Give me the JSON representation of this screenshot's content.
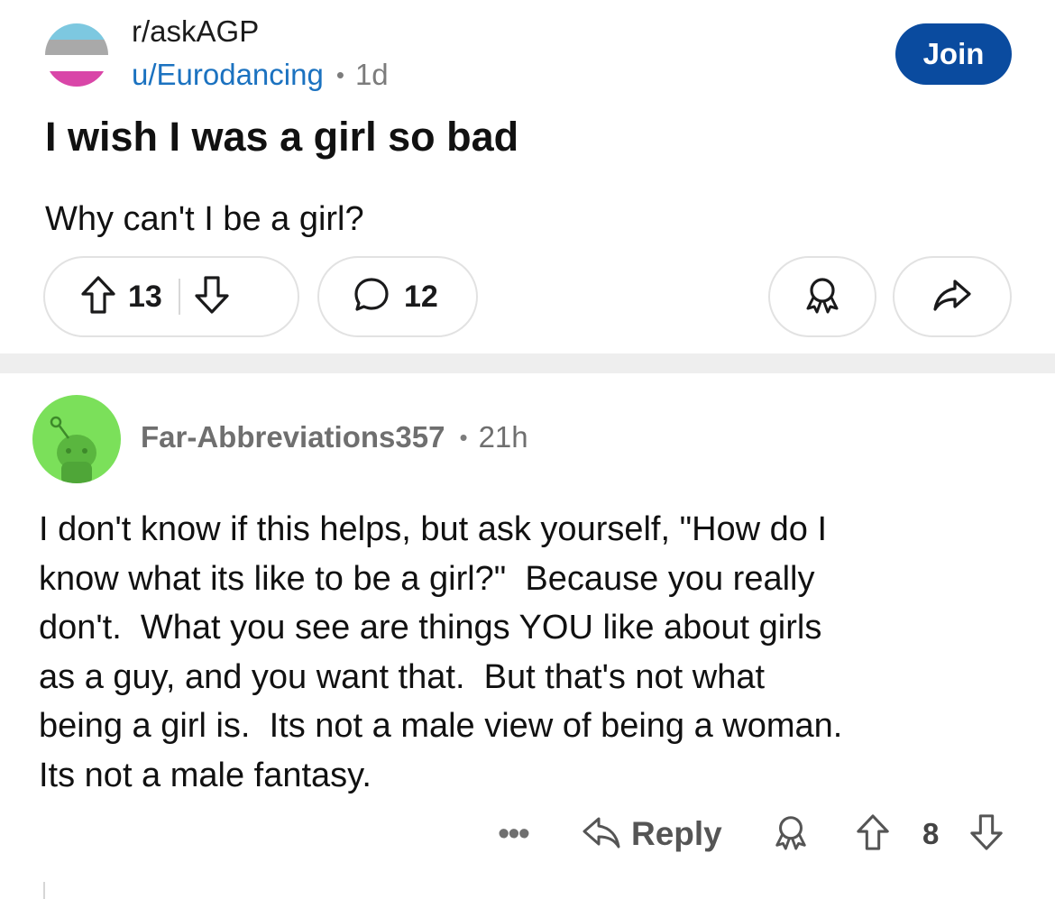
{
  "post": {
    "subreddit": "r/askAGP",
    "author": "u/Eurodancing",
    "separator": "•",
    "age": "1d",
    "join_label": "Join",
    "title": "I wish I was a girl so bad",
    "body": "Why can't I be a girl?",
    "upvotes": "13",
    "comment_count": "12",
    "avatar_colors": [
      "#7dc8e0",
      "#a9a9a9",
      "#ffffff",
      "#d946a8"
    ]
  },
  "comment": {
    "author": "Far-Abbreviations357",
    "separator": "•",
    "age": "21h",
    "body_lines": [
      "I don't know if this helps, but ask yourself, \"How do I",
      "know what its like to be a girl?\"  Because you really",
      "don't.  What you see are things YOU like about girls",
      "as a guy, and you want that.  But that's not what",
      "being a girl is.  Its not a male view of being a woman.",
      "Its not a male fantasy."
    ],
    "more_label": "•••",
    "reply_label": "Reply",
    "score": "8",
    "avatar_color": "#7be05a"
  },
  "icons": {
    "upvote": "upvote-arrow-icon",
    "downvote": "downvote-arrow-icon",
    "comment": "speech-bubble-icon",
    "award": "award-icon",
    "share": "share-arrow-icon",
    "reply": "reply-arrow-icon"
  }
}
